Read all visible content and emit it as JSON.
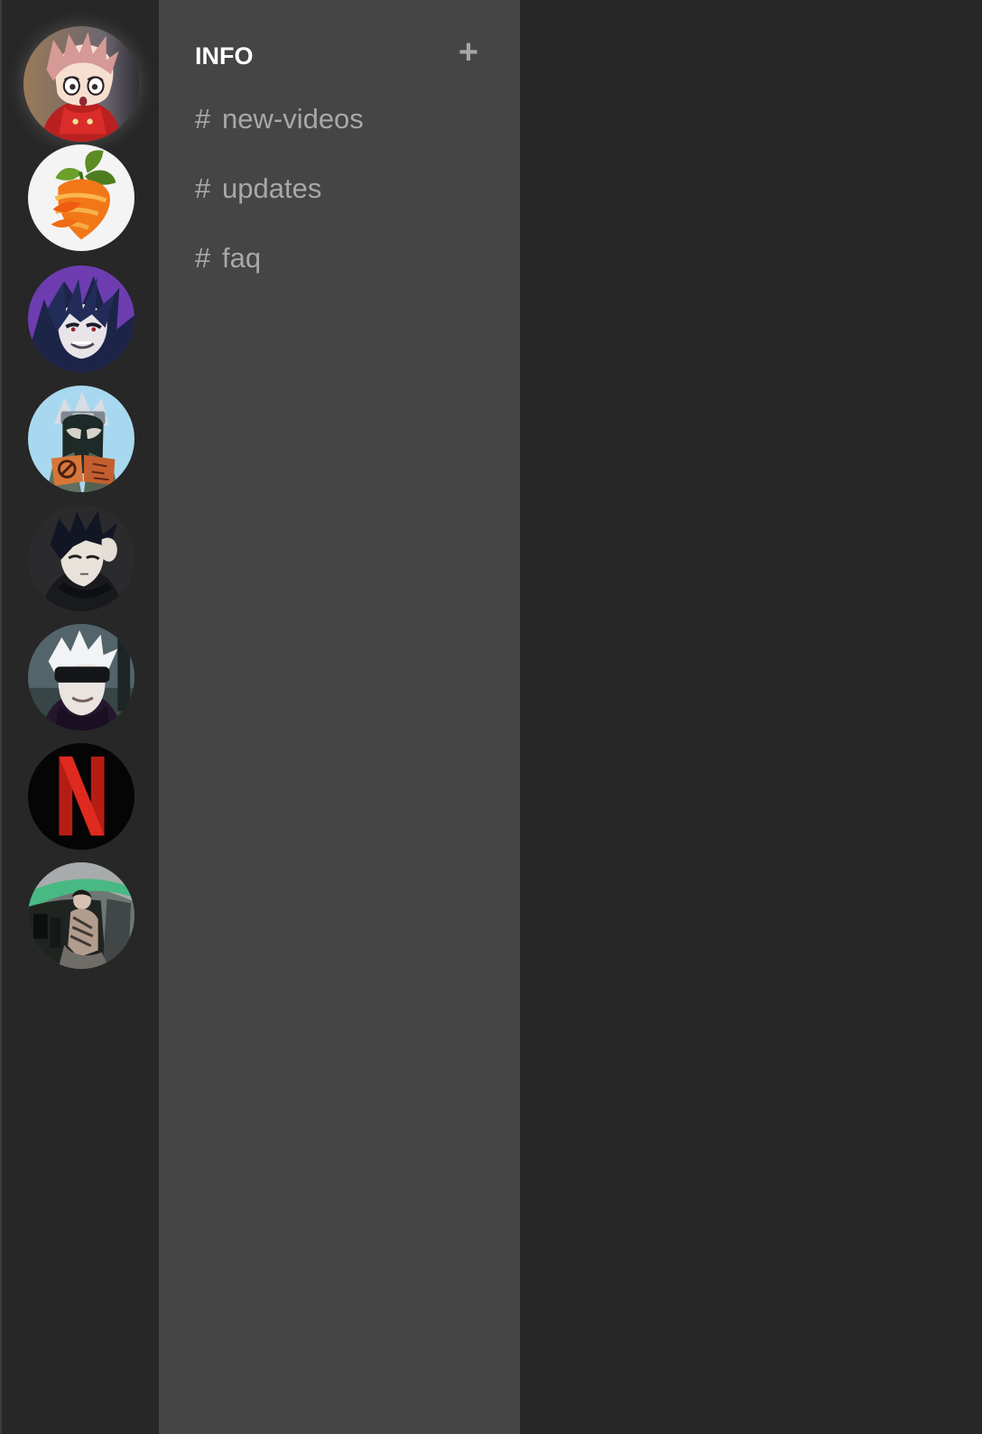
{
  "server_rail": {
    "servers": [
      {
        "icon": "pink-haired-anime-avatar-icon",
        "active": true
      },
      {
        "icon": "fl-studio-fruit-icon",
        "active": false
      },
      {
        "icon": "dark-haired-purple-anime-avatar-icon",
        "active": false
      },
      {
        "icon": "masked-ninja-avatar-icon",
        "active": false
      },
      {
        "icon": "black-haired-anime-avatar-icon",
        "active": false
      },
      {
        "icon": "blindfolded-anime-avatar-icon",
        "active": false
      },
      {
        "icon": "netflix-logo-icon",
        "active": false
      },
      {
        "icon": "room-photo-avatar-icon",
        "active": false
      }
    ],
    "colors": {
      "background": "#272727",
      "divider": "#3c3c3c"
    }
  },
  "channel_panel": {
    "category": {
      "title": "INFO",
      "add_label": "+"
    },
    "channels": [
      {
        "hash": "#",
        "name": "new-videos"
      },
      {
        "hash": "#",
        "name": "updates"
      },
      {
        "hash": "#",
        "name": "faq"
      }
    ],
    "colors": {
      "background": "#454545",
      "title": "#ffffff",
      "channel_text": "#a8a8a8"
    }
  },
  "content": {
    "colors": {
      "background": "#272727"
    }
  }
}
